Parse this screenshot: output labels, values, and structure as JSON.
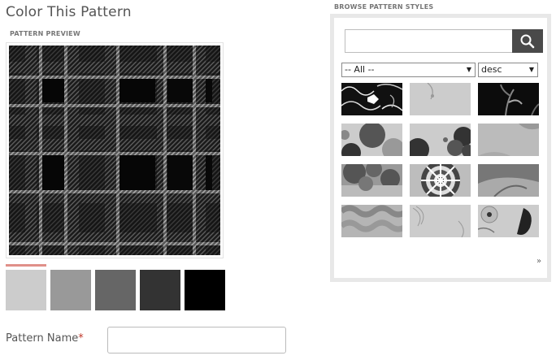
{
  "page": {
    "title": "Color This Pattern",
    "preview_label": "PATTERN PREVIEW",
    "pattern_name_label": "Pattern Name",
    "required_mark": "*",
    "pattern_name_value": ""
  },
  "palette": {
    "selected_index": 0,
    "swatches": [
      "#cccccc",
      "#999999",
      "#666666",
      "#333333",
      "#000000"
    ]
  },
  "browser": {
    "label": "BROWSE PATTERN STYLES",
    "search_value": "",
    "search_icon": "magnifier-icon",
    "category_select": "-- All --",
    "order_select": "desc",
    "more_link": "»",
    "thumbnails": [
      "tribal-floral",
      "circle-swirl",
      "leaf-stems",
      "round-blobs",
      "cloud-flowers",
      "soft-waves",
      "rose-clusters",
      "mosaic-medallion",
      "leaf-overlap",
      "wavy-stripes",
      "line-swirls",
      "paisley-bird"
    ]
  }
}
